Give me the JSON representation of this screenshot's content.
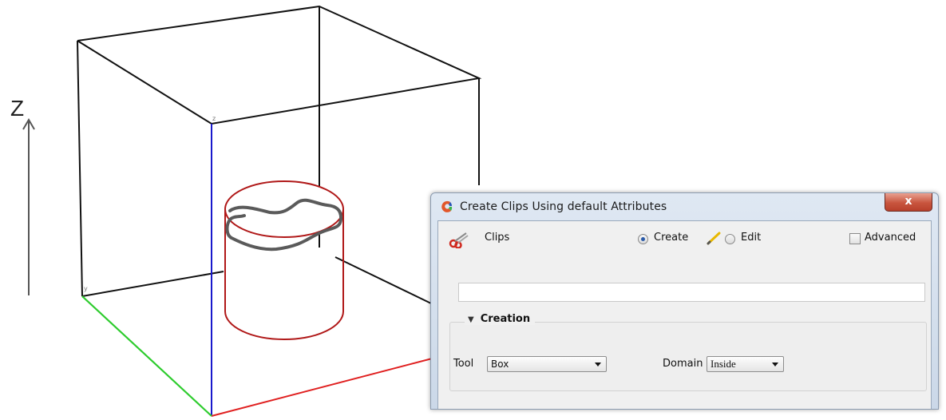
{
  "scene": {
    "axis_label": "Z",
    "corner_label_top": "z",
    "corner_label_left": "y",
    "colors": {
      "box_edges": "#111111",
      "axis_x": "#e02020",
      "axis_y": "#2ecc2e",
      "axis_z": "#1a1acc",
      "cylinder": "#b01818",
      "clip_curve": "#5a5a5a",
      "arrow": "#555555"
    }
  },
  "dialog": {
    "title": "Create Clips Using default Attributes",
    "close_glyph": "x",
    "clips_label": "Clips",
    "mode": {
      "create_label": "Create",
      "edit_label": "Edit",
      "selected": "Create"
    },
    "advanced_label": "Advanced",
    "advanced_checked": false,
    "name_value": "",
    "creation": {
      "header": "Creation",
      "tool_label": "Tool",
      "tool_value": "Box",
      "domain_label": "Domain",
      "domain_value": "Inside"
    }
  }
}
